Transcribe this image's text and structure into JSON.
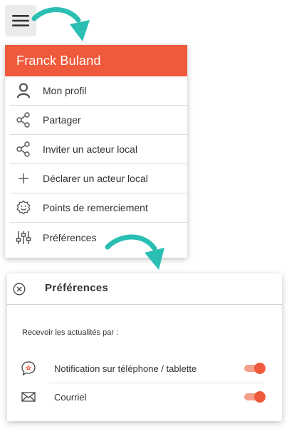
{
  "menu": {
    "user_name": "Franck Buland",
    "items": [
      {
        "label": "Mon profil",
        "icon": "user-icon"
      },
      {
        "label": "Partager",
        "icon": "share-icon"
      },
      {
        "label": "Inviter un acteur local",
        "icon": "share-icon"
      },
      {
        "label": "Déclarer un acteur local",
        "icon": "plus-icon"
      },
      {
        "label": "Points de remerciement",
        "icon": "badge-icon"
      },
      {
        "label": "Préférences",
        "icon": "sliders-icon"
      }
    ]
  },
  "preferences": {
    "title": "Préférences",
    "subtitle": "Recevoir les actualités par :",
    "options": [
      {
        "label": "Notification sur téléphone / tablette",
        "icon": "chat-bubble-icon",
        "enabled": true
      },
      {
        "label": "Courriel",
        "icon": "envelope-icon",
        "enabled": true
      }
    ]
  },
  "colors": {
    "accent": "#f05a3c",
    "arrow": "#2bbfb3",
    "toggle_track": "#f2a08c"
  }
}
